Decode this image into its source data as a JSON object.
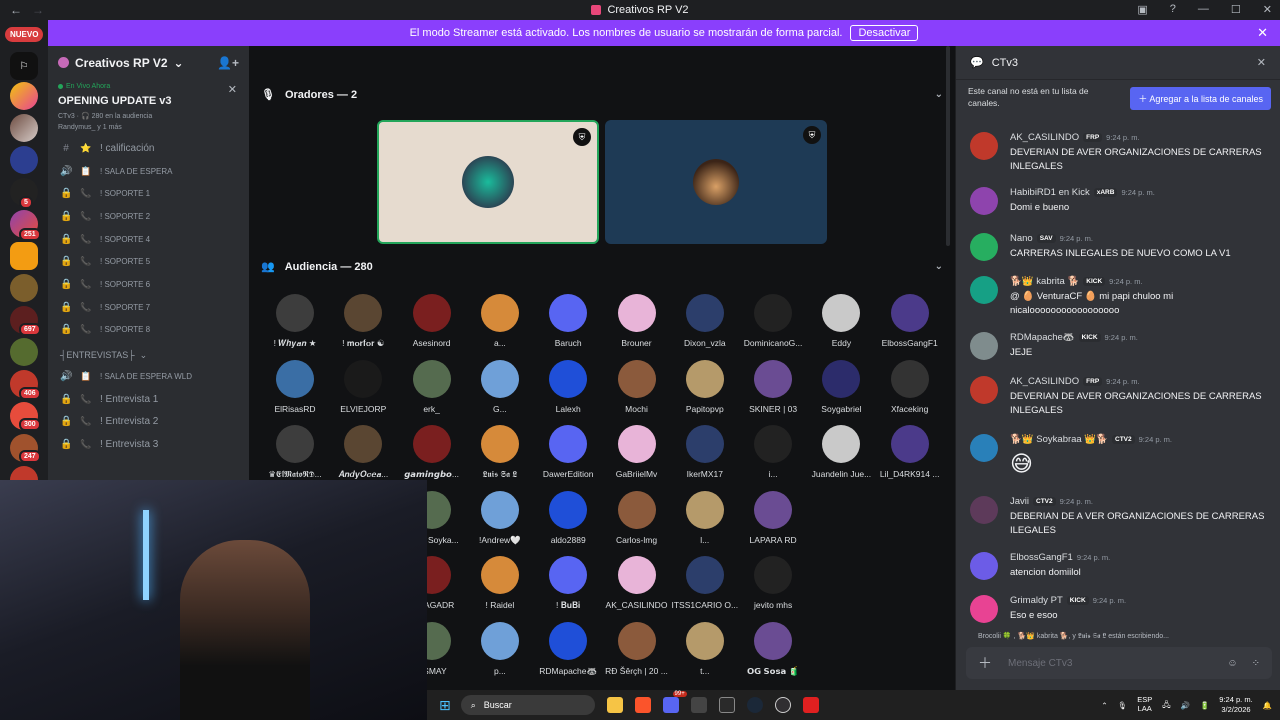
{
  "window": {
    "title": "Creativos RP V2"
  },
  "banner": {
    "text": "El modo Streamer está activado. Los nombres de usuario se mostrarán de forma parcial.",
    "button": "Desactivar"
  },
  "guilds": {
    "new_label": "NUEVO",
    "badges": [
      "5",
      "251",
      "697",
      "406",
      "300",
      "247"
    ]
  },
  "server": {
    "name": "Creativos RP V2"
  },
  "live": {
    "status": "En Vivo Ahora",
    "title": "OPENING UPDATE v3",
    "meta": "CTv3 · 🎧 280 en la audiencia",
    "users": "Randymus_ y 1 más"
  },
  "channels": [
    {
      "icon": "#",
      "emo": "⭐",
      "label": "! calificación",
      "small": false
    },
    {
      "icon": "🔊",
      "emo": "📋",
      "label": "! SALA DE ESPERA",
      "small": true
    },
    {
      "icon": "🔒",
      "emo": "📞",
      "label": "! SOPORTE 1",
      "small": true
    },
    {
      "icon": "🔒",
      "emo": "📞",
      "label": "! SOPORTE 2",
      "small": true
    },
    {
      "icon": "🔒",
      "emo": "📞",
      "label": "! SOPORTE 4",
      "small": true
    },
    {
      "icon": "🔒",
      "emo": "📞",
      "label": "! SOPORTE 5",
      "small": true
    },
    {
      "icon": "🔒",
      "emo": "📞",
      "label": "! SOPORTE 6",
      "small": true
    },
    {
      "icon": "🔒",
      "emo": "📞",
      "label": "! SOPORTE 7",
      "small": true
    },
    {
      "icon": "🔒",
      "emo": "📞",
      "label": "! SOPORTE 8",
      "small": true
    }
  ],
  "category2": "┤ENTREVISTAS├",
  "channels2": [
    {
      "icon": "🔊",
      "emo": "📋",
      "label": "! SALA DE ESPERA WLD",
      "small": true
    },
    {
      "icon": "🔒",
      "emo": "📞",
      "label": "! Entrevista 1",
      "small": false
    },
    {
      "icon": "🔒",
      "emo": "📞",
      "label": "! Entrevista 2",
      "small": false
    },
    {
      "icon": "🔒",
      "emo": "📞",
      "label": "! Entrevista 3",
      "small": false
    }
  ],
  "stage": {
    "speakers_title": "Oradores — 2",
    "audience_title": "Audiencia — 280"
  },
  "audience": [
    [
      "! 𝑾𝒉𝒚𝒂𝒏 ★",
      "! 𝐦𝐨𝐫𝐟𝐨𝐫 ☯",
      "Asesinord",
      "a...",
      "Baruch",
      "Brouner",
      "Dixon_vzla",
      "DominicanoG...",
      "Eddy",
      "ElbossGangF1"
    ],
    [
      "ElRisasRD",
      "ELVIEJORP",
      "erk_",
      "G...",
      "Lalexh",
      "Mochi",
      "Papitopvp",
      "SKINER | 03",
      "Soygabriel",
      "Xfaceking"
    ],
    [
      "♛𝕰𝖑𝕸𝖆𝖙𝖔𝕽𝕯...",
      "𝑨𝒏𝒅𝒚𝑶𝒄𝒆𝒂...",
      "𝙜𝙖𝙢𝙞𝙣𝙜𝙗𝙤...",
      "𝕷𝖚𝖎𝖘 𝕾𝖆 𝕷",
      "DawerEdition",
      "GaBriielMv",
      "IkerMX17",
      "i...",
      "Juandelin Jue...",
      "Lil_D4RK914 ..."
    ],
    [
      "𝑾𝒂? 🍒",
      "Barajita",
      "🐕👑 Soyka...",
      "!Andrew🤍",
      "aldo2889",
      "Carlos-lmg",
      "l...",
      "LAPARA RD",
      "",
      ""
    ],
    [
      "Y...",
      "! 𝑫𝒊𝒆𝒈𝒐 ☠",
      "! PLAGADR",
      "! Raidel",
      "! 𝐁𝐮𝐁𝐢",
      "AK_CASILINDO",
      "ITSS1CARIO O...",
      "jevito mhs",
      "",
      ""
    ],
    [
      "",
      "M...",
      "OSMAY",
      "p...",
      "RDMapache🦝",
      "RĐ Šêrçh | 20 ...",
      "t...",
      "𝗢𝗚 𝗦𝗼𝘀𝗮 🧃",
      "",
      ""
    ]
  ],
  "chat": {
    "channel": "CTv3",
    "notice": "Este canal no está en tu lista de canales.",
    "add_button": "＋ Agregar a la lista de canales",
    "messages": [
      {
        "name": "AK_CASILINDO",
        "badges": "FRP",
        "time": "9:24 p. m.",
        "text": "DEVERIAN DE AVER  ORGANIZACIONES  DE CARRERAS INLEGALES",
        "color": "#c0392b"
      },
      {
        "name": "HabibiRD1 en Kick",
        "badges": "xARB",
        "time": "9:24 p. m.",
        "text": "Domi e bueno",
        "color": "#8e44ad"
      },
      {
        "name": "Nano",
        "badges": "SAV",
        "time": "9:24 p. m.",
        "text": "CARRERAS INLEGALES DE NUEVO COMO LA V1",
        "color": "#27ae60"
      },
      {
        "name": "🐕👑 kabrita 🐕",
        "badges": "KICK",
        "time": "9:24 p. m.",
        "text": "@ 🥚 VenturaCF 🥚  mi papi chuloo mi nicalooooooooooooooooo",
        "color": "#16a085"
      },
      {
        "name": "RDMapache🦝",
        "badges": "KICK",
        "time": "9:24 p. m.",
        "text": "JEJE",
        "color": "#7f8c8d"
      },
      {
        "name": "AK_CASILINDO",
        "badges": "FRP",
        "time": "9:24 p. m.",
        "text": "DEVERIAN DE AVER  ORGANIZACIONES  DE CARRERAS INLEGALES",
        "color": "#c0392b"
      },
      {
        "name": "🐕👑 Soykabraa 👑🐕",
        "badges": "CTV2",
        "time": "9:24 p. m.",
        "text": "😅",
        "color": "#2980b9"
      },
      {
        "name": "Javii",
        "badges": "CTV2",
        "time": "9:24 p. m.",
        "text": "DEBERIAN DE A VER ORGANIZACIONES DE CARRERAS ILEGALES",
        "color": "#5d3a5a"
      },
      {
        "name": "ElbossGangF1",
        "badges": "",
        "time": "9:24 p. m.",
        "text": "atencion domiilol",
        "color": "#6c5ce7"
      },
      {
        "name": "Grimaldy PT",
        "badges": "KICK",
        "time": "9:24 p. m.",
        "text": "Eso e esoo",
        "color": "#e84393"
      }
    ],
    "typing": "Brocolii 🍀 , 🐕👑 kabrita 🐕, y 𝕷𝖚𝖎𝖘 𝕾𝖆 𝕷 están escribiendo...",
    "input_placeholder": "Mensaje CTv3"
  },
  "taskbar": {
    "search": "Buscar",
    "lang": "ESP\nLAA",
    "time": "9:24 p. m.",
    "date": "3/2/2026",
    "badge": "99+"
  }
}
